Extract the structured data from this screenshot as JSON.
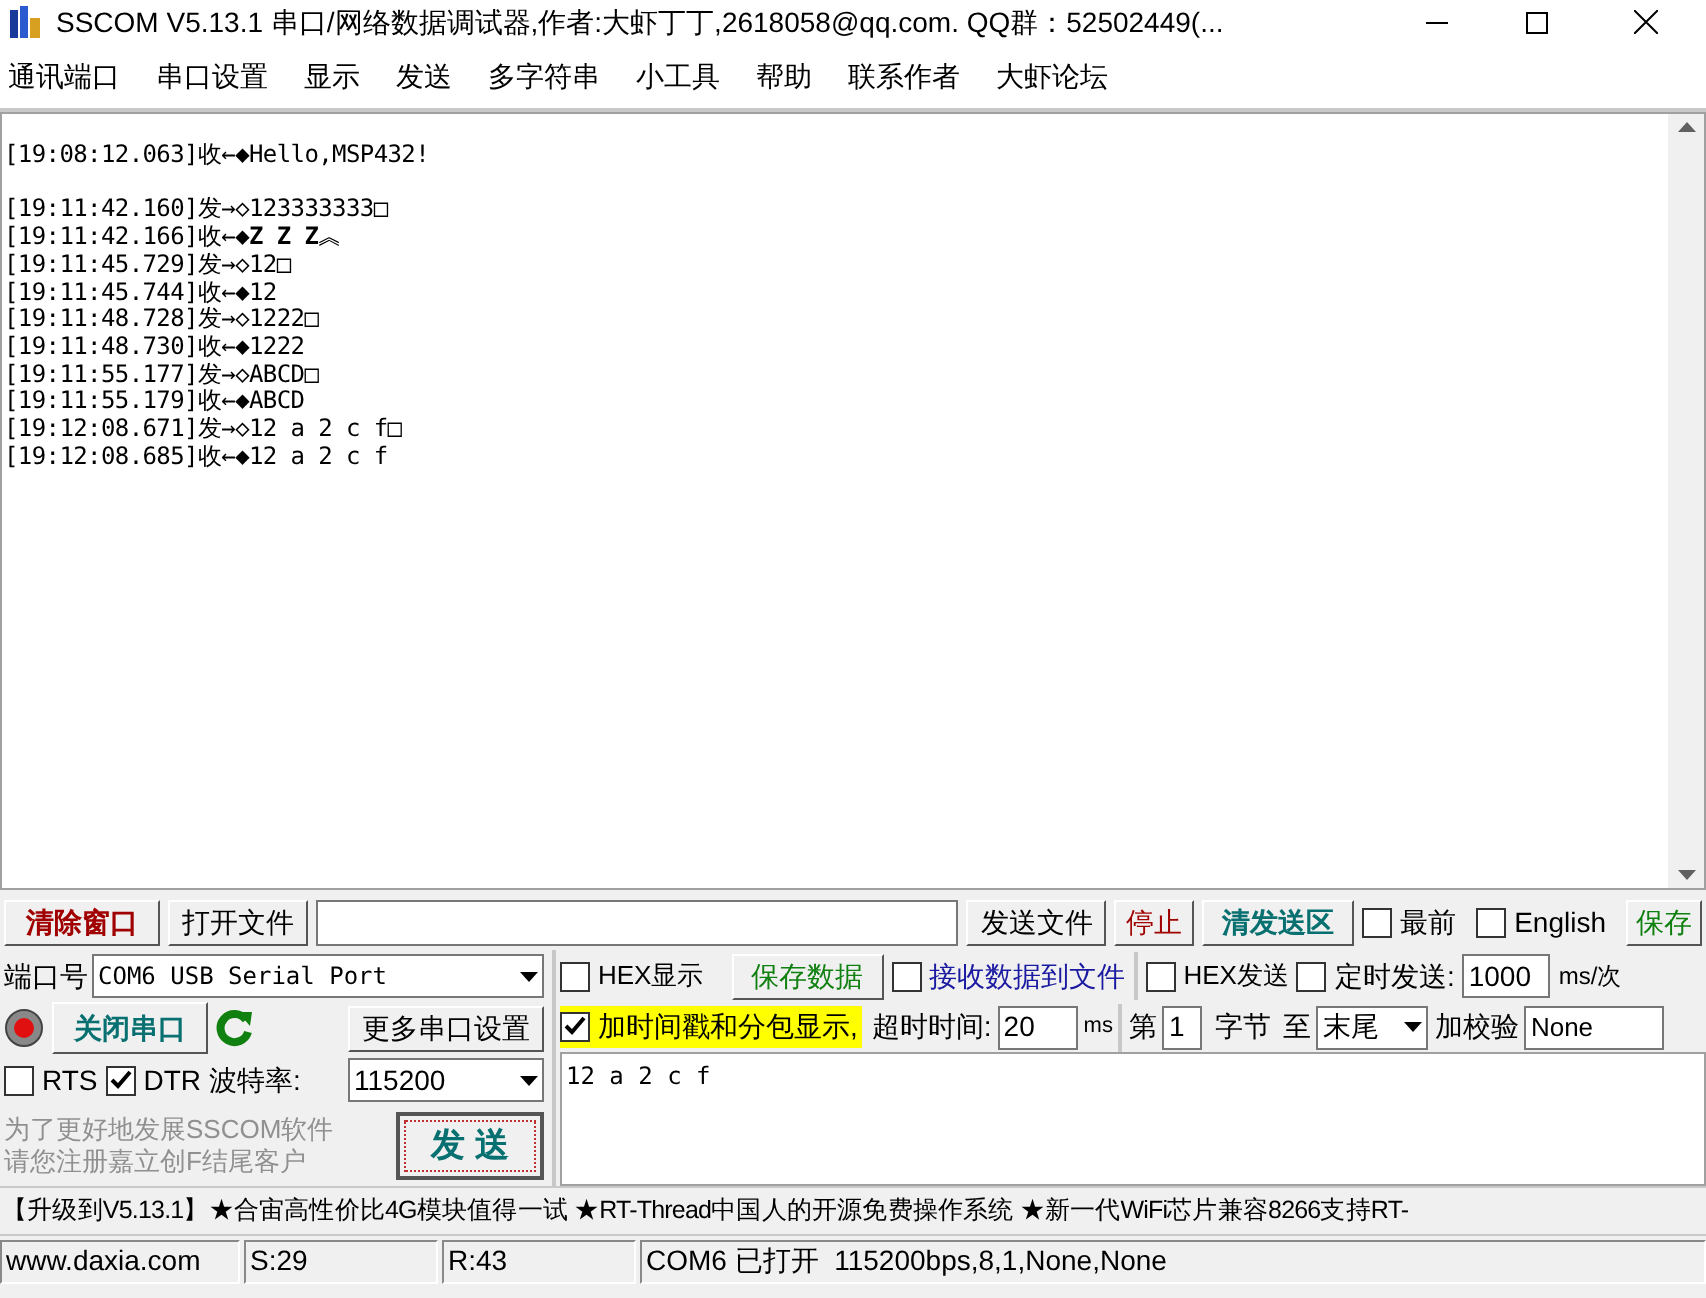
{
  "window": {
    "title": "SSCOM V5.13.1 串口/网络数据调试器,作者:大虾丁丁,2618058@qq.com. QQ群：52502449(..."
  },
  "menu": [
    "通讯端口",
    "串口设置",
    "显示",
    "发送",
    "多字符串",
    "小工具",
    "帮助",
    "联系作者",
    "大虾论坛"
  ],
  "log": {
    "blocks": [
      [
        "[19:08:12.063]收←◆Hello,MSP432!"
      ],
      [
        "[19:11:42.160]发→◇123333333□",
        "[19:11:42.166]收←◆**Z Z Z**︽",
        "[19:11:45.729]发→◇12□",
        "[19:11:45.744]收←◆12",
        "[19:11:48.728]发→◇1222□",
        "[19:11:48.730]收←◆1222",
        "[19:11:55.177]发→◇ABCD□",
        "[19:11:55.179]收←◆ABCD",
        "[19:12:08.671]发→◇12 a 2 c f□",
        "[19:12:08.685]收←◆12 a 2 c f"
      ]
    ]
  },
  "toolbar": {
    "clear_button": "清除窗口",
    "open_file_button": "打开文件",
    "send_file_button": "发送文件",
    "stop_button": "停止",
    "clear_send_button": "清发送区",
    "checkboxes": [
      {
        "label": "最前",
        "checked": false
      },
      {
        "label": "English",
        "checked": false
      }
    ],
    "save_button": "保存"
  },
  "port_panel": {
    "port_label": "端口号",
    "port_value": "COM6 USB Serial Port",
    "toggle_port_button": "关闭串口",
    "more_settings_button": "更多串口设置",
    "lines": [
      {
        "label": "RTS",
        "checked": false
      },
      {
        "label": "DTR",
        "checked": true
      }
    ],
    "baud_label": "波特率:",
    "baud_value": "115200",
    "notice": [
      "为了更好地发展SSCOM软件",
      "请您注册嘉立创F结尾客户"
    ],
    "send_button": "发 送"
  },
  "receive_options": {
    "hex_display": {
      "label": "HEX显示",
      "checked": false
    },
    "save_data_button": "保存数据",
    "save_to_file": {
      "label": "接收数据到文件",
      "checked": false
    },
    "timestamp": {
      "label": "加时间戳和分包显示,",
      "checked": true
    },
    "timeout_label": "超时时间:",
    "timeout_value": "20",
    "timeout_unit": "ms"
  },
  "send_options": {
    "hex_send": {
      "label": "HEX发送",
      "checked": false
    },
    "timed_send": {
      "label": "定时发送:",
      "checked": false
    },
    "interval_value": "1000",
    "interval_unit": "ms/次",
    "from_label": "第",
    "from_value": "1",
    "byte_label": "字节",
    "to_label": "至",
    "to_value": "末尾",
    "checksum_label": "加校验",
    "checksum_value": "None"
  },
  "send_text": "12 a 2 c f",
  "ticker": "【升级到V5.13.1】★合宙高性价比4G模块值得一试 ★RT-Thread中国人的开源免费操作系统 ★新一代WiFi芯片兼容8266支持RT-",
  "status_bar": [
    "www.daxia.com",
    "S:29",
    "R:43",
    "COM6 已打开  115200bps,8,1,None,None"
  ]
}
